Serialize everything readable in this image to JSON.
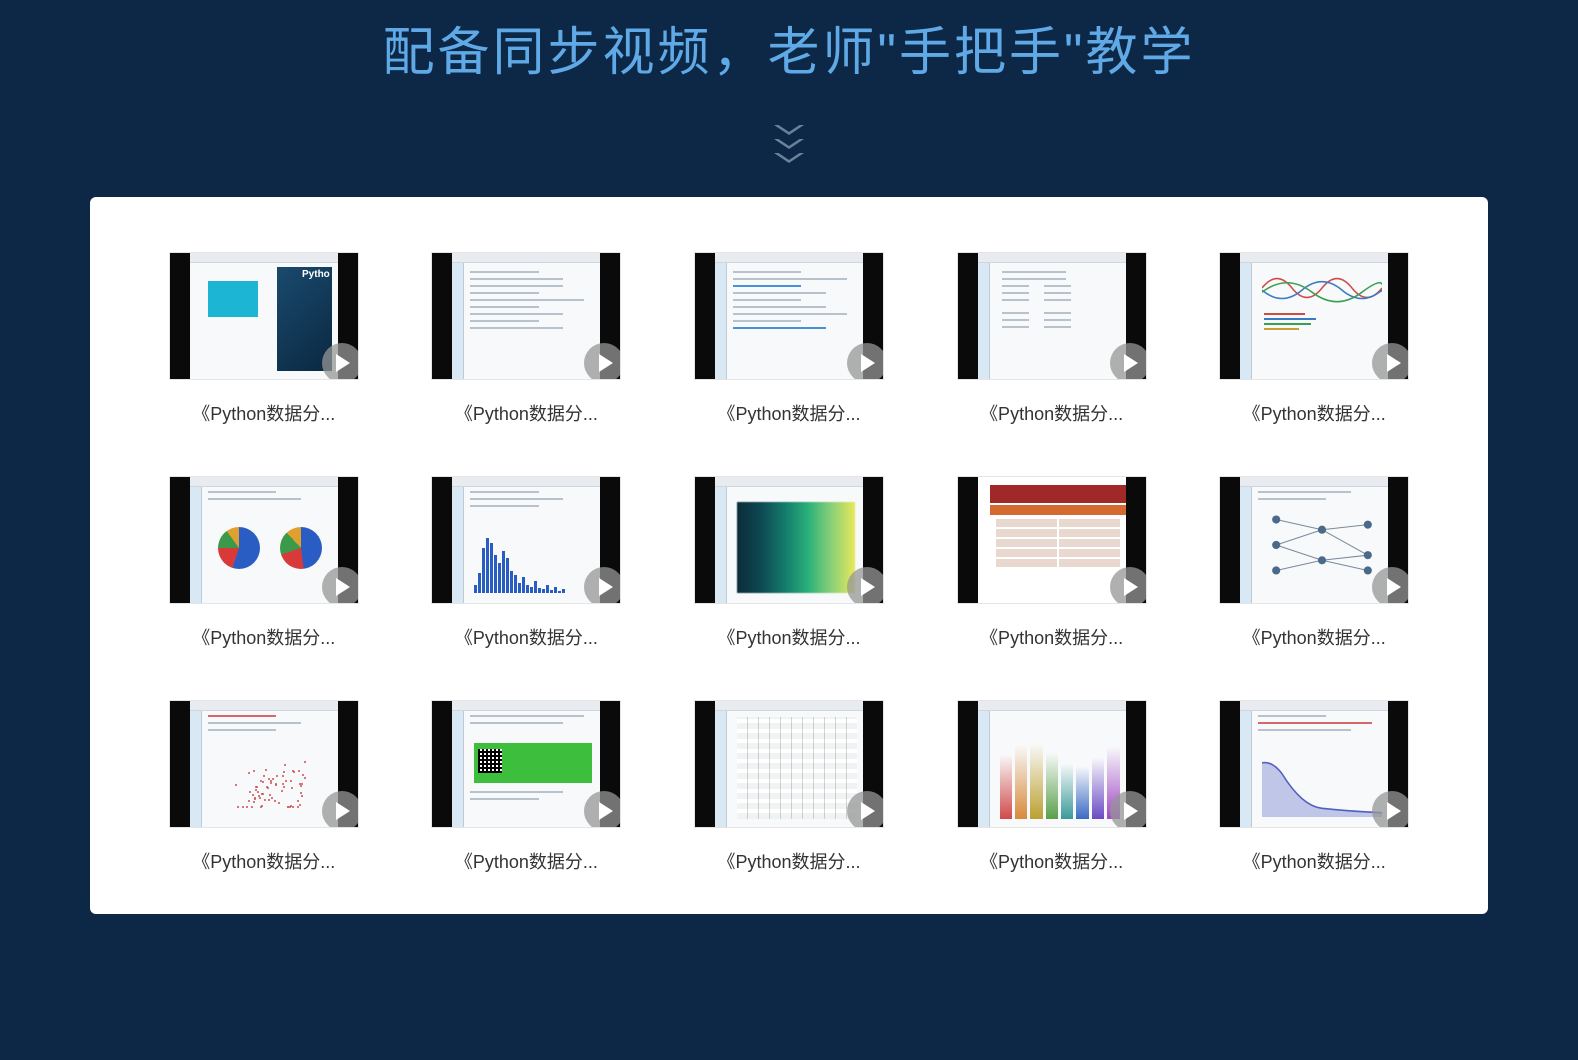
{
  "header": {
    "title": "配备同步视频，老师\"手把手\"教学"
  },
  "videos": [
    {
      "caption": "《Python数据分..."
    },
    {
      "caption": "《Python数据分..."
    },
    {
      "caption": "《Python数据分..."
    },
    {
      "caption": "《Python数据分..."
    },
    {
      "caption": "《Python数据分..."
    },
    {
      "caption": "《Python数据分..."
    },
    {
      "caption": "《Python数据分..."
    },
    {
      "caption": "《Python数据分..."
    },
    {
      "caption": "《Python数据分..."
    },
    {
      "caption": "《Python数据分..."
    },
    {
      "caption": "《Python数据分..."
    },
    {
      "caption": "《Python数据分..."
    },
    {
      "caption": "《Python数据分..."
    },
    {
      "caption": "《Python数据分..."
    },
    {
      "caption": "《Python数据分..."
    }
  ],
  "thumb_badge": "Pytho"
}
